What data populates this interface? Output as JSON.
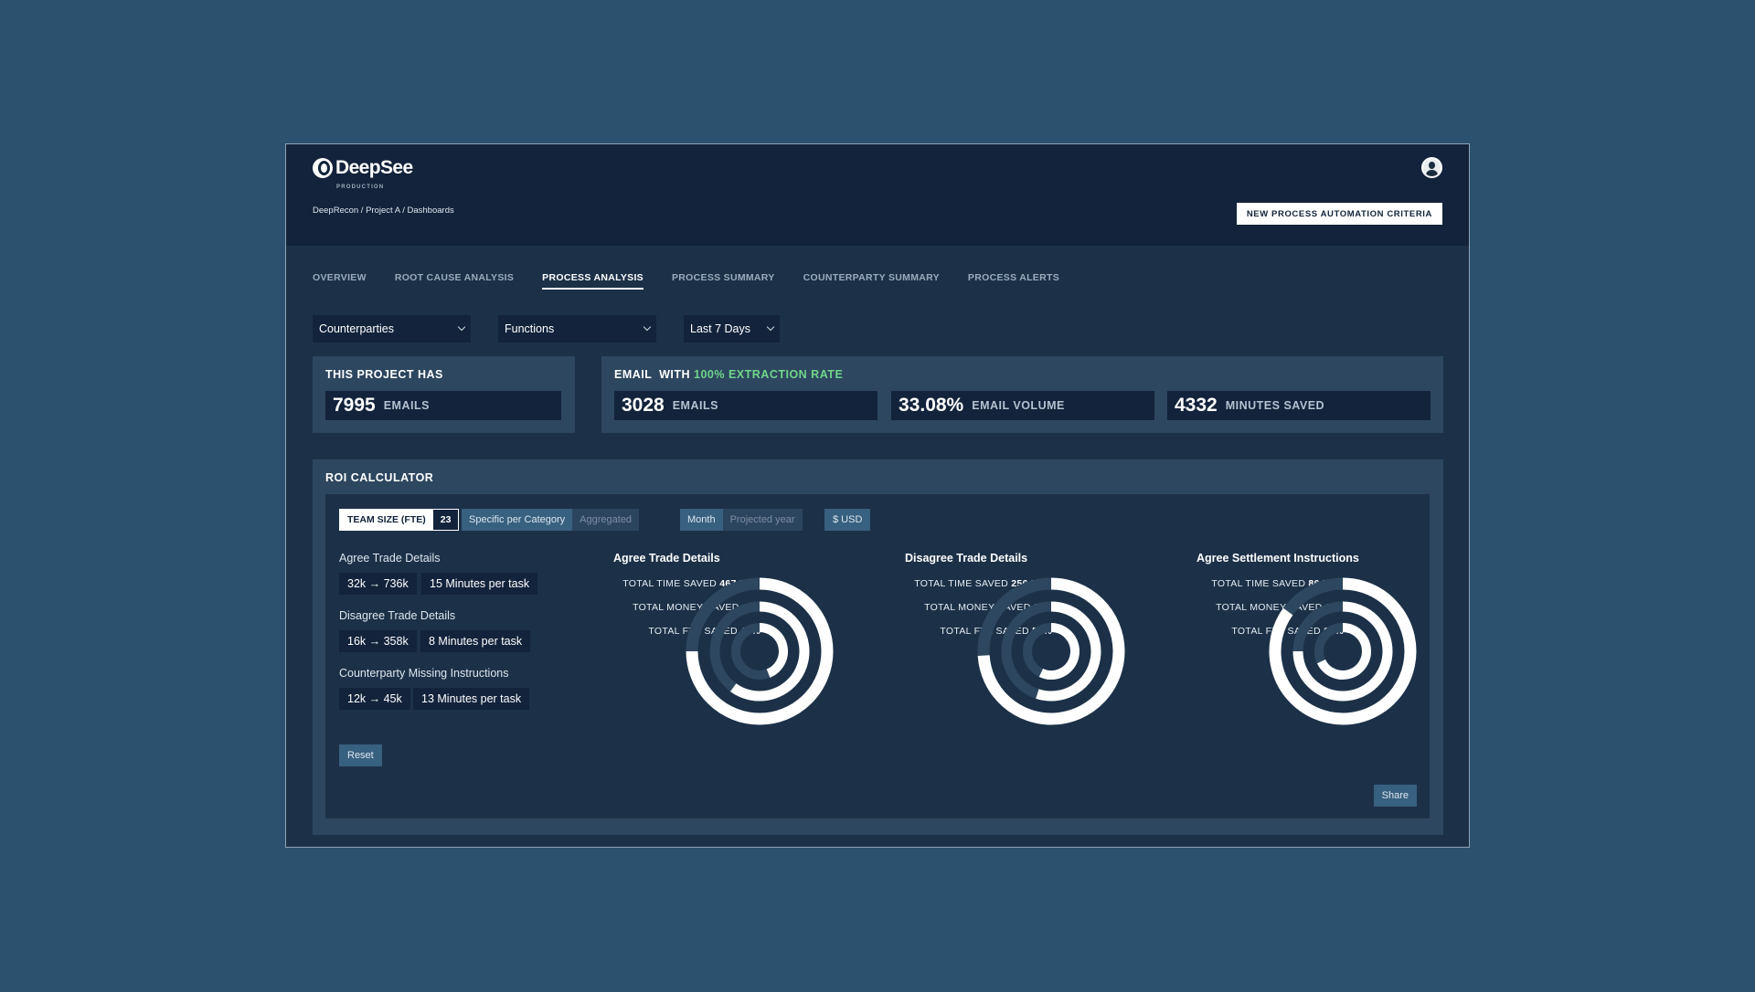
{
  "app": {
    "name": "DeepSee",
    "env": "PRODUCTION",
    "breadcrumb": "DeepRecon  / Project A / Dashboards",
    "cta": "NEW PROCESS AUTOMATION CRITERIA"
  },
  "tabs": [
    {
      "label": "OVERVIEW",
      "active": false
    },
    {
      "label": "ROOT CAUSE ANALYSIS",
      "active": false
    },
    {
      "label": "PROCESS ANALYSIS",
      "active": true
    },
    {
      "label": "PROCESS SUMMARY",
      "active": false
    },
    {
      "label": "COUNTERPARTY SUMMARY",
      "active": false
    },
    {
      "label": "PROCESS ALERTS",
      "active": false
    }
  ],
  "filters": {
    "counterparties": "Counterparties",
    "functions": "Functions",
    "period": "Last 7 Days"
  },
  "project": {
    "title": "THIS PROJECT HAS",
    "value": "7995",
    "unit": "EMAILS"
  },
  "extraction": {
    "title_a": "EMAIL  WITH ",
    "title_b": "100% EXTRACTION RATE",
    "stats": [
      {
        "value": "3028",
        "label": "EMAILS"
      },
      {
        "value": "33.08%",
        "label": "EMAIL VOLUME"
      },
      {
        "value": "4332",
        "label": "MINUTES SAVED"
      }
    ]
  },
  "roi": {
    "title": "ROI CALCULATOR",
    "team_label": "TEAM SIZE (FTE)",
    "team_value": "23",
    "mode_a": "Specific per Category",
    "mode_b": "Aggregated",
    "period_a": "Month",
    "period_b": "Projected year",
    "currency": "$ USD",
    "categories": [
      {
        "name": "Agree Trade Details",
        "range": "32k → 736k",
        "time": "15 Minutes per task"
      },
      {
        "name": "Disagree Trade Details",
        "range": "16k → 358k",
        "time": "8 Minutes per task"
      },
      {
        "name": "Counterparty Missing Instructions",
        "range": "12k → 45k",
        "time": "13 Minutes per task"
      }
    ],
    "reset": "Reset",
    "share": "Share",
    "charts": [
      {
        "title": "Agree Trade Details",
        "time_label": "TOTAL TIME SAVED",
        "time_value": "467 HRS",
        "money_label": "TOTAL MONEY SAVED",
        "money_value": "42K",
        "fte_label": "TOTAL FTE SAVED",
        "fte_value": "44%"
      },
      {
        "title": "Disagree Trade Details",
        "time_label": "TOTAL TIME SAVED",
        "time_value": "256 HRS",
        "money_label": "TOTAL MONEY SAVED",
        "money_value": "24K",
        "fte_label": "TOTAL FTE SAVED",
        "fte_value": "57%"
      },
      {
        "title": "Agree Settlement Instructions",
        "time_label": "TOTAL TIME SAVED",
        "time_value": "86 HRS",
        "money_label": "TOTAL MONEY SAVED",
        "money_value": "18K",
        "fte_label": "TOTAL FTE SAVED",
        "fte_value": "68%"
      }
    ]
  },
  "colors": {
    "page_bg": "#2c516f",
    "panel_bg": "#1c3148",
    "card_bg": "#2e4760",
    "dark": "#12233b",
    "accent_green": "#6fd68a",
    "ring_track": "#2e4760",
    "ring_fill": "#ffffff"
  },
  "chart_data": [
    {
      "type": "radial_bar",
      "title": "Agree Trade Details",
      "series": [
        {
          "name": "TOTAL TIME SAVED",
          "fraction": 0.75
        },
        {
          "name": "TOTAL MONEY SAVED",
          "fraction": 0.6
        },
        {
          "name": "TOTAL FTE SAVED",
          "fraction": 0.44
        }
      ]
    },
    {
      "type": "radial_bar",
      "title": "Disagree Trade Details",
      "series": [
        {
          "name": "TOTAL TIME SAVED",
          "fraction": 0.74
        },
        {
          "name": "TOTAL MONEY SAVED",
          "fraction": 0.55
        },
        {
          "name": "TOTAL FTE SAVED",
          "fraction": 0.57
        }
      ]
    },
    {
      "type": "radial_bar",
      "title": "Agree Settlement Instructions",
      "series": [
        {
          "name": "TOTAL TIME SAVED",
          "fraction": 0.85
        },
        {
          "name": "TOTAL MONEY SAVED",
          "fraction": 0.75
        },
        {
          "name": "TOTAL FTE SAVED",
          "fraction": 0.68
        }
      ]
    }
  ]
}
